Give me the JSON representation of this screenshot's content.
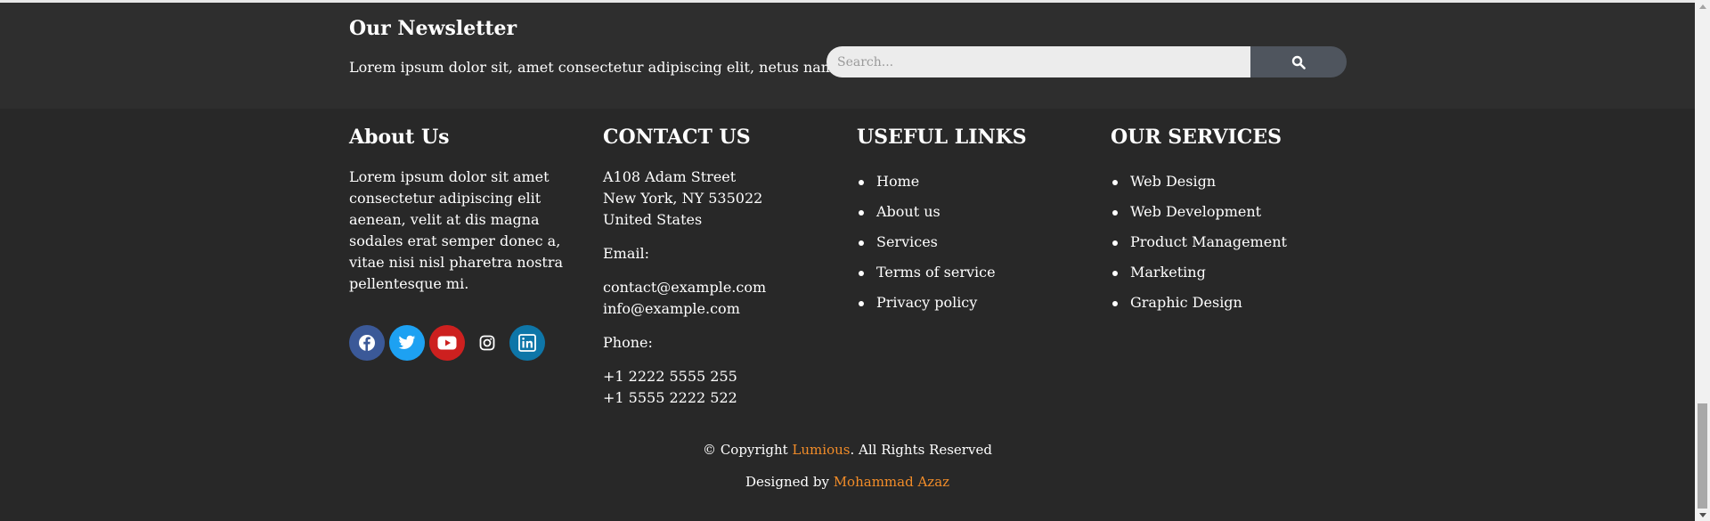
{
  "newsletter": {
    "title": "Our Newsletter",
    "text": "Lorem ipsum dolor sit, amet consectetur adipiscing elit, netus nam.",
    "search_placeholder": "Search...",
    "search_icon": "search-icon"
  },
  "about": {
    "heading": "About Us",
    "text": "Lorem ipsum dolor sit amet consectetur adipiscing elit aenean, velit at dis magna sodales erat semper donec a, vitae nisi nisl pharetra nostra pellentesque mi.",
    "socials": [
      {
        "name": "facebook-icon",
        "color": "#3b5998"
      },
      {
        "name": "twitter-icon",
        "color": "#1da1f2"
      },
      {
        "name": "youtube-icon",
        "color": "#cd201f"
      },
      {
        "name": "instagram-icon",
        "color": "transparent"
      },
      {
        "name": "linkedin-icon",
        "color": "#0e76a8"
      }
    ]
  },
  "contact": {
    "heading": "CONTACT US",
    "address_line1": "A108 Adam Street",
    "address_line2": "New York, NY 535022",
    "address_line3": "United States",
    "email_label": "Email:",
    "email1": "contact@example.com",
    "email2": "info@example.com",
    "phone_label": "Phone:",
    "phone1": "+1 2222 5555 255",
    "phone2": "+1 5555 2222 522"
  },
  "useful_links": {
    "heading": "USEFUL LINKS",
    "items": [
      "Home",
      "About us",
      "Services",
      "Terms of service",
      "Privacy policy"
    ]
  },
  "services": {
    "heading": "OUR SERVICES",
    "items": [
      "Web Design",
      "Web Development",
      "Product Management",
      "Marketing",
      "Graphic Design"
    ]
  },
  "footer": {
    "copyright_prefix": "© Copyright ",
    "brand": "Lumious",
    "copyright_suffix": ". All Rights Reserved",
    "designed_prefix": "Designed by ",
    "designer": "Mohammad Azaz"
  },
  "colors": {
    "background": "#282828",
    "newsletter_band": "#2e2e2e",
    "accent": "#f28c28",
    "search_button": "#4f555e"
  }
}
